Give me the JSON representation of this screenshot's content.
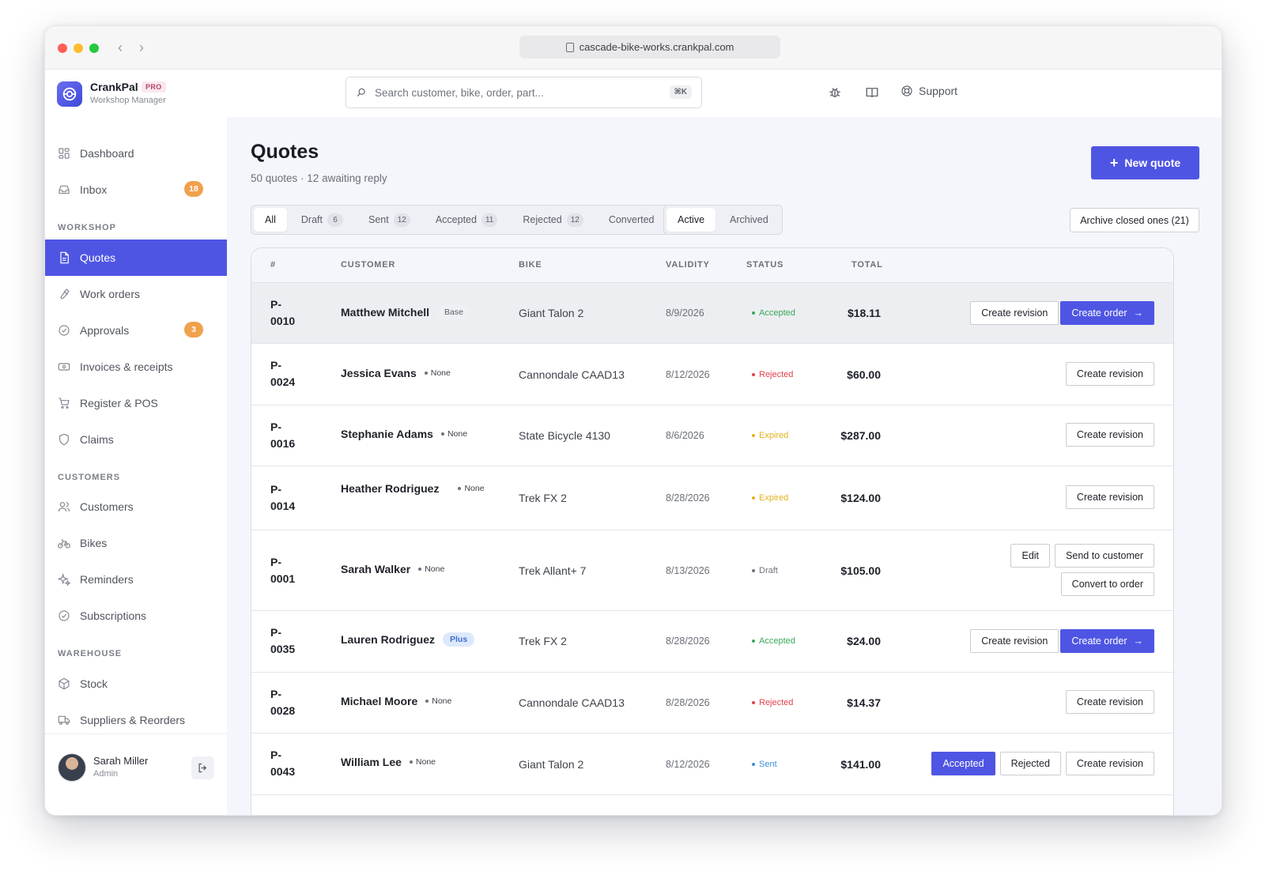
{
  "browser": {
    "url": "cascade-bike-works.crankpal.com"
  },
  "brand": {
    "name": "CrankPal",
    "tag": "PRO",
    "subtitle": "Workshop Manager"
  },
  "search": {
    "placeholder": "Search customer, bike, order, part...",
    "shortcut": "⌘K"
  },
  "topbar": {
    "support_label": "Support"
  },
  "sidebar": {
    "items": [
      {
        "label": "Dashboard",
        "icon": "grid-icon"
      },
      {
        "label": "Inbox",
        "icon": "inbox-icon",
        "badge": "18"
      },
      {
        "label": "Quotes",
        "icon": "document-icon",
        "active": true
      },
      {
        "label": "Work orders",
        "icon": "wrench-icon"
      },
      {
        "label": "Approvals",
        "icon": "check-circle-icon",
        "badge": "3"
      },
      {
        "label": "Invoices & receipts",
        "icon": "receipt-icon"
      },
      {
        "label": "Register & POS",
        "icon": "cart-icon"
      },
      {
        "label": "Claims",
        "icon": "shield-icon"
      },
      {
        "label": "Customers",
        "icon": "users-icon"
      },
      {
        "label": "Bikes",
        "icon": "bike-icon"
      },
      {
        "label": "Reminders",
        "icon": "sparkle-icon"
      },
      {
        "label": "Subscriptions",
        "icon": "check-circle-icon"
      },
      {
        "label": "Stock",
        "icon": "box-icon"
      },
      {
        "label": "Suppliers & Reorders",
        "icon": "truck-icon"
      }
    ],
    "sections": {
      "workshop": "WORKSHOP",
      "customers": "CUSTOMERS",
      "warehouse": "WAREHOUSE"
    },
    "user": {
      "name": "Sarah Miller",
      "role": "Admin"
    }
  },
  "page": {
    "title": "Quotes",
    "subtitle": "50 quotes · 12 awaiting reply",
    "new_quote_label": "New quote",
    "archive_label": "Archive closed ones (21)"
  },
  "filters": {
    "status_tabs": [
      {
        "label": "All",
        "count": "",
        "active": true
      },
      {
        "label": "Draft",
        "count": "6"
      },
      {
        "label": "Sent",
        "count": "12"
      },
      {
        "label": "Accepted",
        "count": "11"
      },
      {
        "label": "Rejected",
        "count": "12"
      },
      {
        "label": "Converted",
        "count": ""
      }
    ],
    "scope_tabs": [
      {
        "label": "Active",
        "active": true
      },
      {
        "label": "Archived"
      }
    ]
  },
  "table": {
    "headers": {
      "id": "#",
      "customer": "CUSTOMER",
      "bike": "BIKE",
      "validity": "VALIDITY",
      "status": "STATUS",
      "total": "TOTAL"
    },
    "rows": [
      {
        "id_a": "P-",
        "id_b": "0010",
        "customer": "Matthew Mitchell",
        "tier": "Base",
        "bike": "Giant Talon 2",
        "validity": "8/9/2026",
        "status": "Accepted",
        "total": "$18.11",
        "actions": [
          "Create revision",
          "Create order"
        ]
      },
      {
        "id_a": "P-",
        "id_b": "0024",
        "customer": "Jessica Evans",
        "tier": "None",
        "bike": "Cannondale CAAD13",
        "validity": "8/12/2026",
        "status": "Rejected",
        "total": "$60.00",
        "actions": [
          "Create revision"
        ]
      },
      {
        "id_a": "P-",
        "id_b": "0016",
        "customer": "Stephanie Adams",
        "tier": "None",
        "bike": "State Bicycle 4130",
        "validity": "8/6/2026",
        "status": "Expired",
        "total": "$287.00",
        "actions": [
          "Create revision"
        ]
      },
      {
        "id_a": "P-",
        "id_b": "0014",
        "customer": "Heather Rodriguez",
        "tier": "None",
        "bike": "Trek FX 2",
        "validity": "8/28/2026",
        "status": "Expired",
        "total": "$124.00",
        "actions": [
          "Create revision"
        ]
      },
      {
        "id_a": "P-",
        "id_b": "0001",
        "customer": "Sarah Walker",
        "tier": "None",
        "bike": "Trek Allant+ 7",
        "validity": "8/13/2026",
        "status": "Draft",
        "total": "$105.00",
        "actions": [
          "Edit",
          "Send to customer",
          "Convert to order"
        ]
      },
      {
        "id_a": "P-",
        "id_b": "0035",
        "customer": "Lauren Rodriguez",
        "tier": "Plus",
        "bike": "Trek FX 2",
        "validity": "8/28/2026",
        "status": "Accepted",
        "total": "$24.00",
        "actions": [
          "Create revision",
          "Create order"
        ]
      },
      {
        "id_a": "P-",
        "id_b": "0028",
        "customer": "Michael Moore",
        "tier": "None",
        "bike": "Cannondale CAAD13",
        "validity": "8/28/2026",
        "status": "Rejected",
        "total": "$14.37",
        "actions": [
          "Create revision"
        ]
      },
      {
        "id_a": "P-",
        "id_b": "0043",
        "customer": "William Lee",
        "tier": "None",
        "bike": "Giant Talon 2",
        "validity": "8/12/2026",
        "status": "Sent",
        "total": "$141.00",
        "actions": [
          "Accepted",
          "Rejected",
          "Create revision"
        ]
      }
    ]
  },
  "colors": {
    "accent": "#4f55e3",
    "status_accepted": "#3aa857",
    "status_rejected": "#e0424b",
    "status_expired": "#e2b21d",
    "status_draft": "#6f737c",
    "status_sent": "#3b8fd9",
    "badge": "#f0a14b"
  }
}
